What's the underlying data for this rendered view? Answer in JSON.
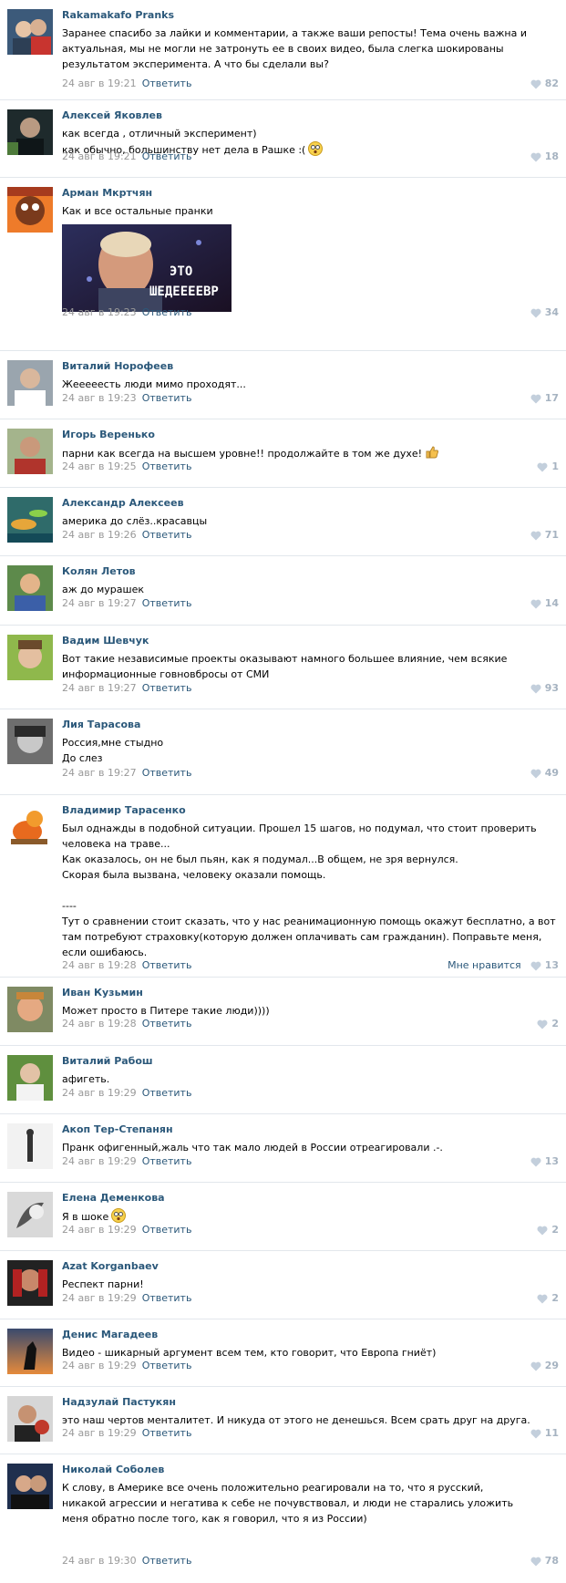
{
  "like_label": "Мне нравится",
  "reply_label": "Ответить",
  "colors": {
    "author": "#2b587a",
    "meta": "#999999",
    "heart": "#a6b3c1",
    "separator": "#e2e7ec"
  },
  "comments": [
    {
      "author": "Rakamakafo Pranks",
      "text": "Заранее спасибо за лайки и комментарии, а также ваши репосты! Тема очень важна и актуальная, мы не могли не затронуть ее в своих видео, была слегка шокированы результатом эксперимента. А что бы сделали вы?",
      "time": "24 авг в 19:21",
      "likes": "82"
    },
    {
      "author": "Алексей Яковлев",
      "text": "как всегда , отличный эксперимент)\nкак обычно, большинству нет дела в Рашке :(",
      "time": "24 авг в 19:21",
      "likes": "18",
      "emoji": "shocked-emoji"
    },
    {
      "author": "Арман Мкртчян",
      "text": "Как и все остальные пранки",
      "time": "24 авг в 19:23",
      "likes": "34",
      "image_caption_1": "ЭТО",
      "image_caption_2": "ШЕДЕЕЕЕВР"
    },
    {
      "author": "Виталий Норофеев",
      "text": "Жееееесть люди мимо проходят...",
      "time": "24 авг в 19:23",
      "likes": "17"
    },
    {
      "author": "Игорь Веренько",
      "text": "парни как всегда на высшем уровне!! продолжайте в том же духе!",
      "time": "24 авг в 19:25",
      "likes": "1",
      "emoji": "thumbs-up-emoji"
    },
    {
      "author": "Александр Алексеев",
      "text": "америка до слёз..красавцы",
      "time": "24 авг в 19:26",
      "likes": "71"
    },
    {
      "author": "Колян Летов",
      "text": "аж до мурашек",
      "time": "24 авг в 19:27",
      "likes": "14"
    },
    {
      "author": "Вадим Шевчук",
      "text": "Вот такие независимые проекты оказывают намного большее влияние, чем всякие информационные говновбросы от СМИ",
      "time": "24 авг в 19:27",
      "likes": "93"
    },
    {
      "author": "Лия Тарасова",
      "text": "Россия,мне стыдно\nДо слез",
      "time": "24 авг в 19:27",
      "likes": "49"
    },
    {
      "author": "Владимир Тарасенко",
      "text": "Был однажды в подобной ситуации. Прошел 15 шагов, но подумал, что стоит проверить человека на траве...\nКак оказалось, он не был пьян, как я подумал...В общем, не зря вернулся.\nСкорая была вызвана, человеку оказали помощь.\n\n----\nТут о сравнении стоит сказать, что у нас реанимационную помощь окажут бесплатно, а вот там потребуют страховку(которую должен оплачивать сам гражданин). Поправьте меня, если ошибаюсь.",
      "time": "24 авг в 19:28",
      "likes": "13",
      "show_like_label": true
    },
    {
      "author": "Иван Кузьмин",
      "text": "Может просто в Питере такие люди))))",
      "time": "24 авг в 19:28",
      "likes": "2"
    },
    {
      "author": "Виталий Рабош",
      "text": "афигеть.",
      "time": "24 авг в 19:29",
      "likes": ""
    },
    {
      "author": "Акоп Тер-Степанян",
      "text": "Пранк офигенный,жаль что так мало людей в России отреагировали .-.",
      "time": "24 авг в 19:29",
      "likes": "13"
    },
    {
      "author": "Елена Деменкова",
      "text": "Я в шоке",
      "time": "24 авг в 19:29",
      "likes": "2",
      "emoji": "shocked-emoji"
    },
    {
      "author": "Azat Korganbaev",
      "text": "Респект парни!",
      "time": "24 авг в 19:29",
      "likes": "2"
    },
    {
      "author": "Денис Магадеев",
      "text": "Видео - шикарный аргумент всем тем, кто говорит, что Европа гниёт)",
      "time": "24 авг в 19:29",
      "likes": "29"
    },
    {
      "author": "Надзулай Пастукян",
      "text": "это наш чертов менталитет. И никуда от этого не денешься. Всем срать друг на друга.",
      "time": "24 авг в 19:29",
      "likes": "11"
    },
    {
      "author": "Николай Соболев",
      "text": "К слову, в Америке все очень положительно реагировали на то, что я русский, никакой агрессии и негатива к себе не почувствовал, и люди не старались уложить меня обратно после того, как я говорил, что я из России)",
      "time": "24 авг в 19:30",
      "likes": "78"
    }
  ]
}
